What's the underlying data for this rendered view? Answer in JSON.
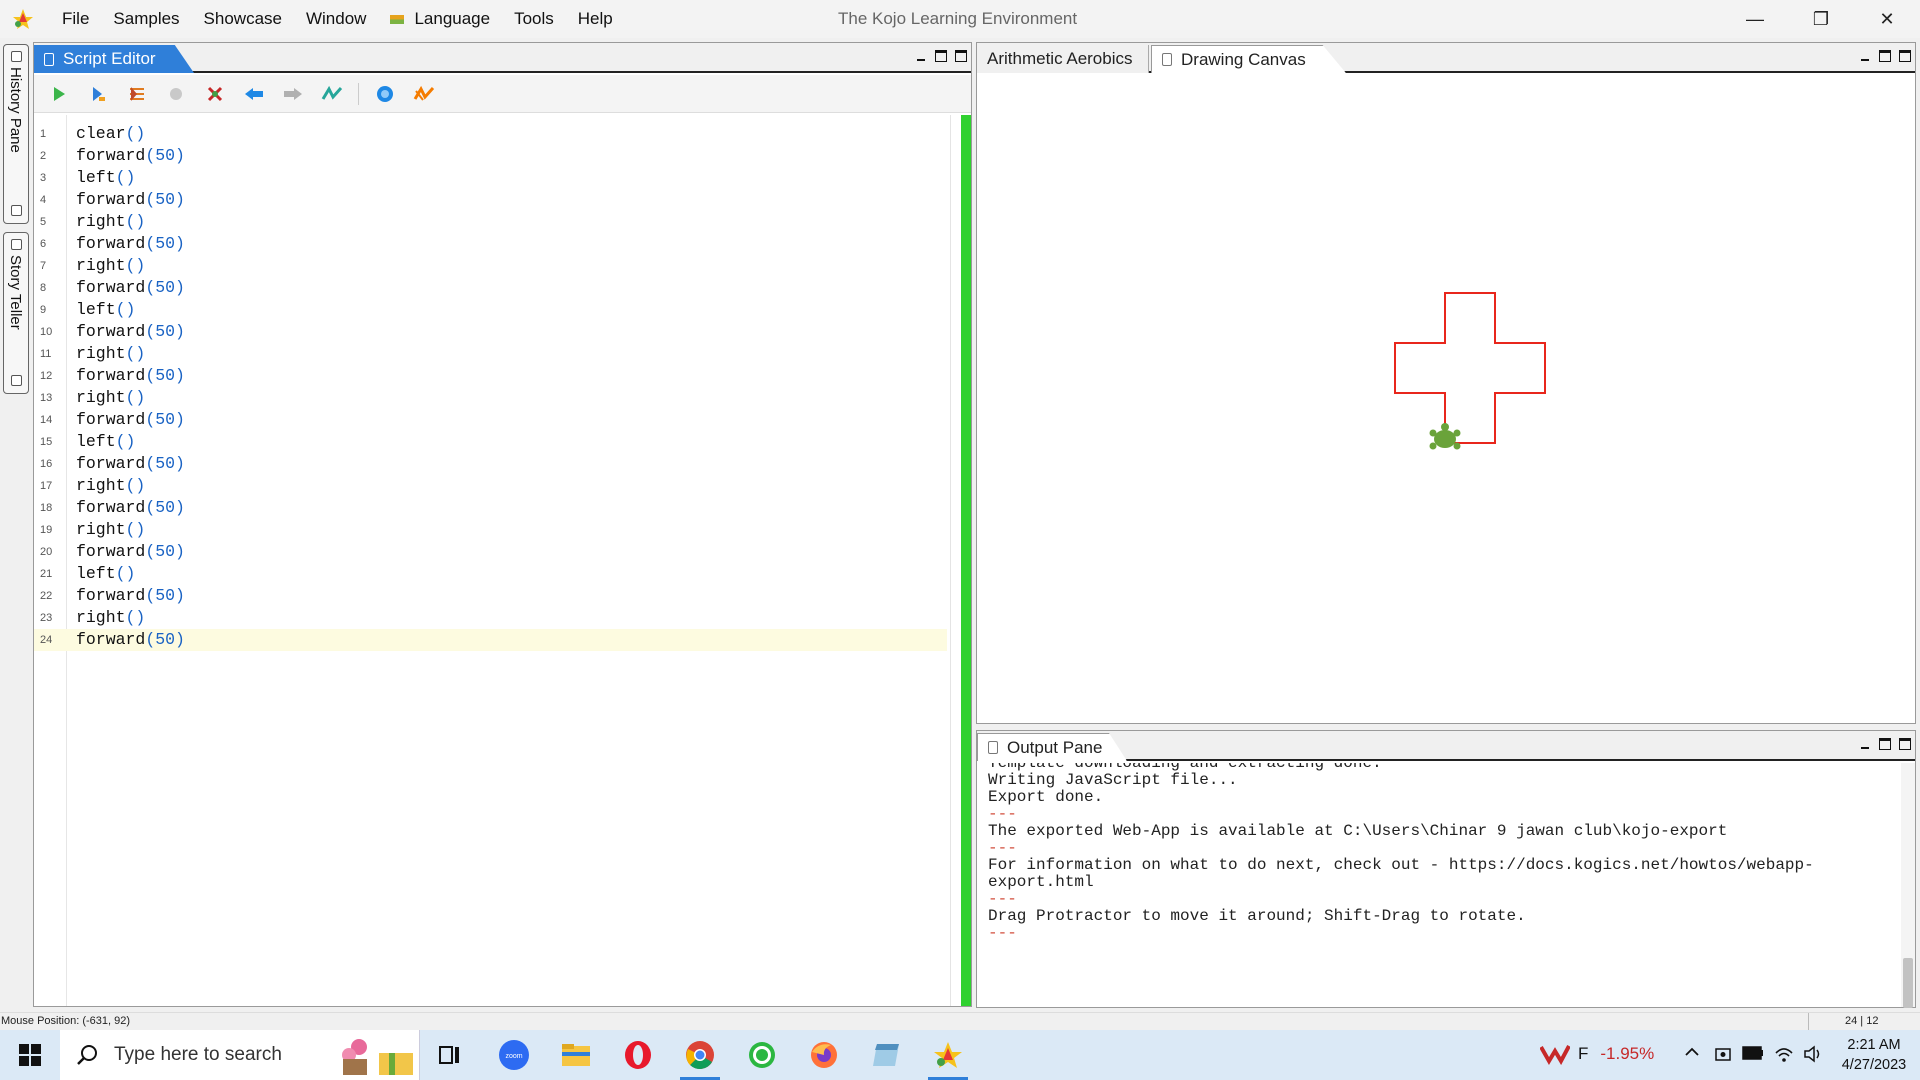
{
  "app": {
    "title": "The Kojo Learning Environment",
    "menu": [
      "File",
      "Samples",
      "Showcase",
      "Window",
      "Language",
      "Tools",
      "Help"
    ],
    "window_controls": {
      "minimize": "—",
      "restore": "❐",
      "close": "✕"
    }
  },
  "side_tabs": {
    "history": "History Pane",
    "story": "Story Teller"
  },
  "script_editor": {
    "tab_label": "Script Editor",
    "toolbar_icons": [
      "run-icon",
      "run-worksheet-icon",
      "trace-icon",
      "stop-icon",
      "clear-icon",
      "undo-icon",
      "redo-icon",
      "format-icon",
      "help-icon",
      "export-icon"
    ],
    "current_line": 24,
    "lines": [
      {
        "n": "1",
        "fn": "clear",
        "args": "()"
      },
      {
        "n": "2",
        "fn": "forward",
        "args": "(50)"
      },
      {
        "n": "3",
        "fn": "left",
        "args": "()"
      },
      {
        "n": "4",
        "fn": "forward",
        "args": "(50)"
      },
      {
        "n": "5",
        "fn": "right",
        "args": "()"
      },
      {
        "n": "6",
        "fn": "forward",
        "args": "(50)"
      },
      {
        "n": "7",
        "fn": "right",
        "args": "()"
      },
      {
        "n": "8",
        "fn": "forward",
        "args": "(50)"
      },
      {
        "n": "9",
        "fn": "left",
        "args": "()"
      },
      {
        "n": "10",
        "fn": "forward",
        "args": "(50)"
      },
      {
        "n": "11",
        "fn": "right",
        "args": "()"
      },
      {
        "n": "12",
        "fn": "forward",
        "args": "(50)"
      },
      {
        "n": "13",
        "fn": "right",
        "args": "()"
      },
      {
        "n": "14",
        "fn": "forward",
        "args": "(50)"
      },
      {
        "n": "15",
        "fn": "left",
        "args": "()"
      },
      {
        "n": "16",
        "fn": "forward",
        "args": "(50)"
      },
      {
        "n": "17",
        "fn": "right",
        "args": "()"
      },
      {
        "n": "18",
        "fn": "forward",
        "args": "(50)"
      },
      {
        "n": "19",
        "fn": "right",
        "args": "()"
      },
      {
        "n": "20",
        "fn": "forward",
        "args": "(50)"
      },
      {
        "n": "21",
        "fn": "left",
        "args": "()"
      },
      {
        "n": "22",
        "fn": "forward",
        "args": "(50)"
      },
      {
        "n": "23",
        "fn": "right",
        "args": "()"
      },
      {
        "n": "24",
        "fn": "forward",
        "args": "(50)"
      }
    ]
  },
  "canvas": {
    "tabs": [
      "Arithmetic Aerobics",
      "Drawing Canvas"
    ],
    "active_tab": "Drawing Canvas",
    "pen_color": "#e8261c",
    "turtle_color": "#6aa33a"
  },
  "output": {
    "tab_label": "Output Pane",
    "lines": [
      {
        "text": "Template downloading and extracting done.",
        "type": "partial"
      },
      {
        "text": "Writing JavaScript file...",
        "type": "normal"
      },
      {
        "text": "Export done.",
        "type": "normal"
      },
      {
        "text": "---",
        "type": "sep"
      },
      {
        "text": "The exported Web-App is available at C:\\Users\\Chinar 9 jawan club\\kojo-export",
        "type": "normal"
      },
      {
        "text": "---",
        "type": "sep"
      },
      {
        "text": "For information on what to do next, check out - https://docs.kogics.net/howtos/webapp-",
        "type": "normal"
      },
      {
        "text": "export.html",
        "type": "normal"
      },
      {
        "text": "---",
        "type": "sep"
      },
      {
        "text": "Drag Protractor to move it around; Shift-Drag to rotate.",
        "type": "normal"
      },
      {
        "text": "---",
        "type": "sep"
      }
    ]
  },
  "status": {
    "mouse_position": "Mouse Position: (-631, 92)",
    "caret": "24 | 12"
  },
  "taskbar": {
    "search_placeholder": "Type here to search",
    "stock_symbol": "F",
    "stock_change": "-1.95%",
    "time": "2:21 AM",
    "date": "4/27/2023",
    "accent": "#2f7fd9"
  }
}
